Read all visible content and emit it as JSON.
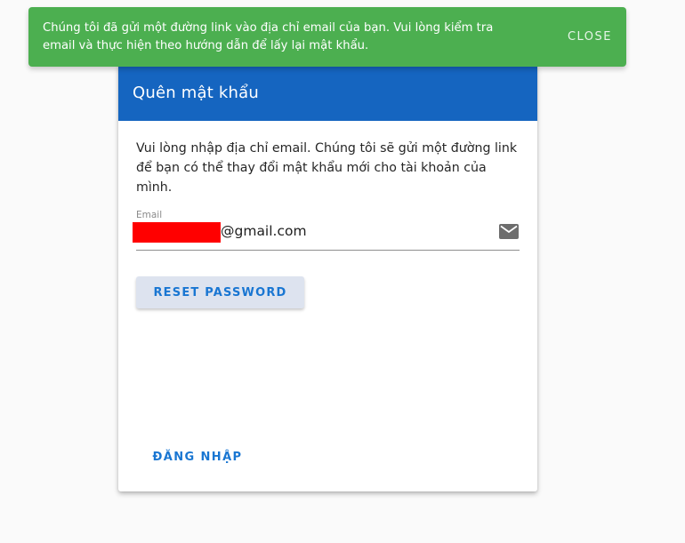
{
  "snackbar": {
    "message": "Chúng tôi đã gửi một đường link vào địa chỉ email của bạn. Vui lòng kiểm tra email và thực hiện theo hướng dẫn để lấy lại mật khẩu.",
    "close_label": "CLOSE",
    "color": "#4caf50"
  },
  "card": {
    "title": "Quên mật khẩu",
    "header_color": "#1565c0",
    "instructions": "Vui lòng nhập địa chỉ email. Chúng tôi sẽ gửi một đường link để bạn có thể thay đổi mật khẩu mới cho tài khoản của mình.",
    "email_field": {
      "label": "Email",
      "value_suffix": "@gmail.com",
      "icon": "mail-icon"
    },
    "reset_button_label": "RESET PASSWORD",
    "login_link_label": "ĐĂNG NHẬP"
  }
}
